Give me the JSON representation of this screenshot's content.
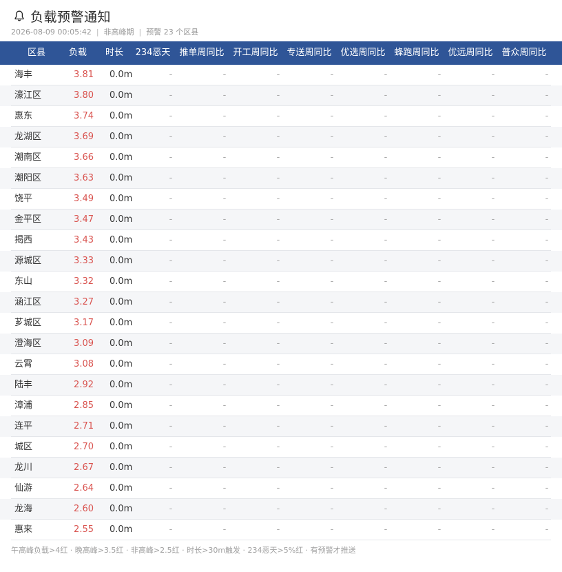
{
  "header": {
    "icon": "bell-icon",
    "title": "负载预警通知",
    "timestamp": "2026-08-09 00:05:42",
    "period": "非高峰期",
    "warning_count": "预警 23 个区县",
    "separator": "|"
  },
  "columns": [
    "区县",
    "负载",
    "时长",
    "234恶天",
    "推单周同比",
    "开工周同比",
    "专送周同比",
    "优选周同比",
    "蜂跑周同比",
    "优远周同比",
    "普众周同比"
  ],
  "rows": [
    {
      "name": "海丰",
      "load": "3.81",
      "duration": "0.0m"
    },
    {
      "name": "濠江区",
      "load": "3.80",
      "duration": "0.0m"
    },
    {
      "name": "惠东",
      "load": "3.74",
      "duration": "0.0m"
    },
    {
      "name": "龙湖区",
      "load": "3.69",
      "duration": "0.0m"
    },
    {
      "name": "潮南区",
      "load": "3.66",
      "duration": "0.0m"
    },
    {
      "name": "潮阳区",
      "load": "3.63",
      "duration": "0.0m"
    },
    {
      "name": "饶平",
      "load": "3.49",
      "duration": "0.0m"
    },
    {
      "name": "金平区",
      "load": "3.47",
      "duration": "0.0m"
    },
    {
      "name": "揭西",
      "load": "3.43",
      "duration": "0.0m"
    },
    {
      "name": "源城区",
      "load": "3.33",
      "duration": "0.0m"
    },
    {
      "name": "东山",
      "load": "3.32",
      "duration": "0.0m"
    },
    {
      "name": "涵江区",
      "load": "3.27",
      "duration": "0.0m"
    },
    {
      "name": "芗城区",
      "load": "3.17",
      "duration": "0.0m"
    },
    {
      "name": "澄海区",
      "load": "3.09",
      "duration": "0.0m"
    },
    {
      "name": "云霄",
      "load": "3.08",
      "duration": "0.0m"
    },
    {
      "name": "陆丰",
      "load": "2.92",
      "duration": "0.0m"
    },
    {
      "name": "漳浦",
      "load": "2.85",
      "duration": "0.0m"
    },
    {
      "name": "连平",
      "load": "2.71",
      "duration": "0.0m"
    },
    {
      "name": "城区",
      "load": "2.70",
      "duration": "0.0m"
    },
    {
      "name": "龙川",
      "load": "2.67",
      "duration": "0.0m"
    },
    {
      "name": "仙游",
      "load": "2.64",
      "duration": "0.0m"
    },
    {
      "name": "龙海",
      "load": "2.60",
      "duration": "0.0m"
    },
    {
      "name": "惠来",
      "load": "2.55",
      "duration": "0.0m"
    }
  ],
  "empty_value": "-",
  "footer": "午高峰负载>4红 · 晚高峰>3.5红 · 非高峰>2.5红 · 时长>30m触发 · 234恶天>5%红 · 有预警才推送",
  "colors": {
    "header_bg": "#2f5597",
    "load_red": "#d9534f",
    "row_alt": "#f5f6f8"
  }
}
